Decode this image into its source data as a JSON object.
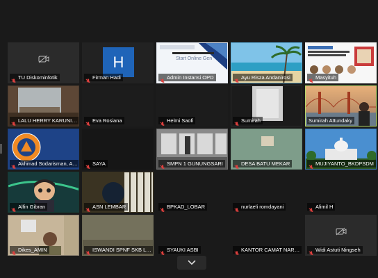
{
  "tiles": [
    {
      "name": "TU Diskominfotik",
      "muted": true,
      "bg": "#2b2b2b",
      "content": "camoff"
    },
    {
      "name": "Firman Hadi",
      "muted": true,
      "bg": "#222",
      "content": "avatarH",
      "letter": "H"
    },
    {
      "name": "Admin Instansi OPD",
      "muted": true,
      "bg": "#e9eef5",
      "content": "slide"
    },
    {
      "name": "Ayu Risza Andanirosi",
      "muted": true,
      "bg": "#5fb0d9",
      "content": "beach"
    },
    {
      "name": "Masyituh",
      "muted": true,
      "bg": "#f3f3f3",
      "content": "poster"
    },
    {
      "name": "LALU HERRY KARUNIAW...",
      "muted": true,
      "bg": "#4b3b2e",
      "content": "room"
    },
    {
      "name": "Eva Rosiana",
      "muted": true,
      "bg": "#1c1c1c",
      "content": "none"
    },
    {
      "name": "Helmi Saofi",
      "muted": true,
      "bg": "#1c1c1c",
      "content": "none"
    },
    {
      "name": "Sumirah",
      "muted": true,
      "bg": "#2a2a2a",
      "content": "door"
    },
    {
      "name": "Sumirah Attundaky",
      "muted": false,
      "bg": "#c99a6b",
      "content": "bridge",
      "active": true
    },
    {
      "name": "Akhmad Sodarisman, A.M...",
      "muted": true,
      "bg": "#1e3e7a",
      "content": "bnpb"
    },
    {
      "name": "SAYA",
      "muted": true,
      "bg": "#161616",
      "content": "none"
    },
    {
      "name": "SMPN 1 GUNUNGSARI",
      "muted": true,
      "bg": "#6c6c6c",
      "content": "class"
    },
    {
      "name": "DESA BATU MEKAR",
      "muted": true,
      "bg": "#6f8e7c",
      "content": "wall"
    },
    {
      "name": "MUJIYANTO_BKDPSDM",
      "muted": true,
      "bg": "#3b78b4",
      "content": "capitol"
    },
    {
      "name": "Alfin Gibran",
      "muted": true,
      "bg": "#173b33",
      "content": "cartoon"
    },
    {
      "name": "ASN LEMBAR",
      "muted": true,
      "bg": "#3a3320",
      "content": "window"
    },
    {
      "name": "BPKAD_LOBAR",
      "muted": true,
      "bg": "#1a1a1a",
      "content": "none"
    },
    {
      "name": "nurlaeli romdayani",
      "muted": true,
      "bg": "#1a1a1a",
      "content": "none"
    },
    {
      "name": "Alimil H",
      "muted": true,
      "bg": "#1a1a1a",
      "content": "none"
    },
    {
      "name": "Dikes_AMIN",
      "muted": true,
      "bg": "#8a8070",
      "content": "person"
    },
    {
      "name": "ISWANDI SPNF SKB LOB...",
      "muted": true,
      "bg": "#6d6a55",
      "content": "blur"
    },
    {
      "name": "SYAUKI ASBI",
      "muted": true,
      "bg": "#1a1a1a",
      "content": "none"
    },
    {
      "name": "KANTOR CAMAT NARMA...",
      "muted": true,
      "bg": "#1a1a1a",
      "content": "none"
    },
    {
      "name": "Widi Astuti Ningseh",
      "muted": true,
      "bg": "#2b2b2b",
      "content": "camoff"
    }
  ],
  "slide": {
    "text": "Start Online Gen"
  },
  "colors": {
    "accent": "#b5d86a",
    "muted_mic": "#e0413f",
    "tile_bg": "#222"
  },
  "bottom_button": {
    "icon": "chevron-down-icon"
  }
}
